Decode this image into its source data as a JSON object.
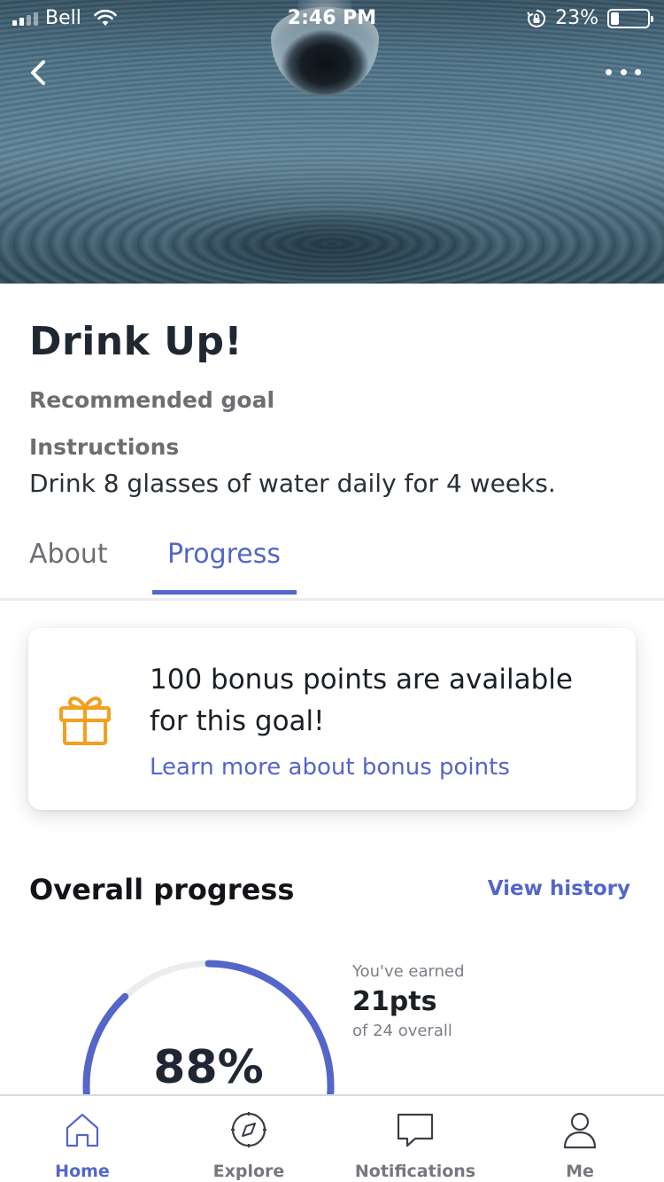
{
  "status_bar": {
    "carrier": "Bell",
    "time": "2:46 PM",
    "battery": "23%",
    "battery_level": 0.23
  },
  "header": {
    "hero_image": "water-drop-ripple",
    "back_icon": "chevron-left-icon",
    "more_icon": "ellipsis-icon"
  },
  "goal": {
    "title": "Drink Up!",
    "recommended": "Recommended goal",
    "instructions_label": "Instructions",
    "instructions_text": "Drink 8 glasses of water daily for 4 weeks."
  },
  "tabs": [
    {
      "label": "About",
      "active": false
    },
    {
      "label": "Progress",
      "active": true
    }
  ],
  "bonus": {
    "icon": "gift-icon",
    "line1": "100 bonus points are available",
    "line2": "for this goal!",
    "link": "Learn more about bonus points"
  },
  "progress": {
    "title": "Overall progress",
    "view_history": "View history",
    "percent_label": "88%",
    "percent_value": 0.88,
    "earned_label": "You've earned",
    "earned_points": "21pts",
    "earned_of": "of 24 overall"
  },
  "tabbar": [
    {
      "label": "Home",
      "icon": "home-icon",
      "active": true
    },
    {
      "label": "Explore",
      "icon": "compass-icon",
      "active": false
    },
    {
      "label": "Notifications",
      "icon": "chat-bubble-icon",
      "active": false
    },
    {
      "label": "Me",
      "icon": "person-icon",
      "active": false
    }
  ],
  "colors": {
    "accent": "#5466c8",
    "gift": "#f2a01e",
    "text_dark": "#1f2733",
    "text_muted": "#6b6e72"
  }
}
